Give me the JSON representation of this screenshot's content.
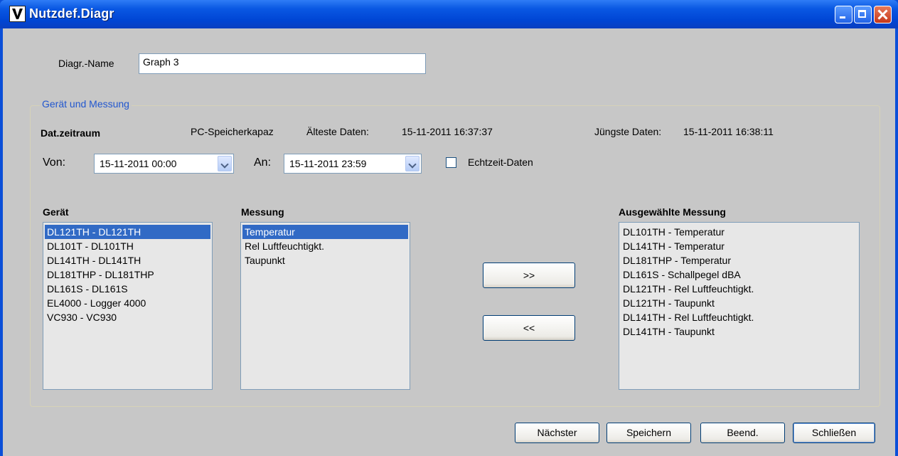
{
  "window": {
    "title": "Nutzdef.Diagr"
  },
  "form": {
    "name_label": "Diagr.-Name",
    "name_value": "Graph 3"
  },
  "group": {
    "title": "Gerät und Messung",
    "period_label": "Dat.zeitraum",
    "capacity_label": "PC-Speicherkapaz",
    "oldest_label": "Älteste Daten:",
    "oldest_value": "15-11-2011 16:37:37",
    "newest_label": "Jüngste Daten:",
    "newest_value": "15-11-2011 16:38:11",
    "from_label": "Von:",
    "from_value": "15-11-2011 00:00",
    "to_label": "An:",
    "to_value": "15-11-2011 23:59",
    "realtime_label": "Echtzeit-Daten",
    "realtime_checked": false
  },
  "devices": {
    "header": "Gerät",
    "items": [
      "DL121TH - DL121TH",
      "DL101T - DL101TH",
      "DL141TH - DL141TH",
      "DL181THP - DL181THP",
      "DL161S - DL161S",
      "EL4000 - Logger 4000",
      "VC930 - VC930"
    ]
  },
  "measurements": {
    "header": "Messung",
    "items": [
      "Temperatur",
      "Rel Luftfeuchtigkt.",
      "Taupunkt"
    ]
  },
  "selected": {
    "header": "Ausgewählte Messung",
    "items": [
      "DL101TH - Temperatur",
      "DL141TH - Temperatur",
      "DL181THP - Temperatur",
      "DL161S - Schallpegel dBA",
      "DL121TH - Rel Luftfeuchtigkt.",
      "DL121TH - Taupunkt",
      "DL141TH - Rel Luftfeuchtigkt.",
      "DL141TH - Taupunkt"
    ]
  },
  "transfer": {
    "add_label": ">>",
    "remove_label": "<<"
  },
  "buttons": {
    "next": "Nächster",
    "save": "Speichern",
    "finish": "Beend.",
    "close": "Schließen"
  }
}
